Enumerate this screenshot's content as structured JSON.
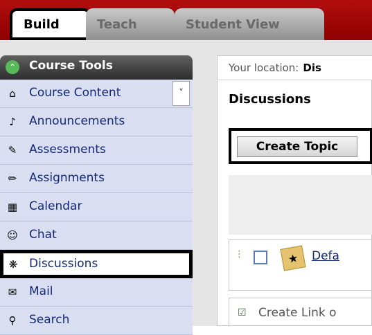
{
  "tabs": {
    "build": "Build",
    "teach": "Teach",
    "student_view": "Student View"
  },
  "sidebar": {
    "header": "Course Tools",
    "header_icon": "double-chevron-up-icon",
    "items": [
      {
        "label": "Course Content",
        "icon": "house-icon"
      },
      {
        "label": "Announcements",
        "icon": "megaphone-icon"
      },
      {
        "label": "Assessments",
        "icon": "clipboard-icon"
      },
      {
        "label": "Assignments",
        "icon": "pencil-paper-icon"
      },
      {
        "label": "Calendar",
        "icon": "calendar-icon"
      },
      {
        "label": "Chat",
        "icon": "speech-bubble-icon"
      },
      {
        "label": "Discussions",
        "icon": "pushpin-icon"
      },
      {
        "label": "Mail",
        "icon": "envelope-icon"
      },
      {
        "label": "Search",
        "icon": "magnifier-icon"
      }
    ]
  },
  "main": {
    "location_label": "Your location:",
    "location_value": "Dis",
    "title": "Discussions",
    "create_topic": "Create Topic",
    "row_link": "Defa",
    "bottom_label": "Create Link o"
  },
  "colors": {
    "topbar": "#a00a0a",
    "sidebar_item_bg": "#d9dff0",
    "link": "#14287a"
  }
}
